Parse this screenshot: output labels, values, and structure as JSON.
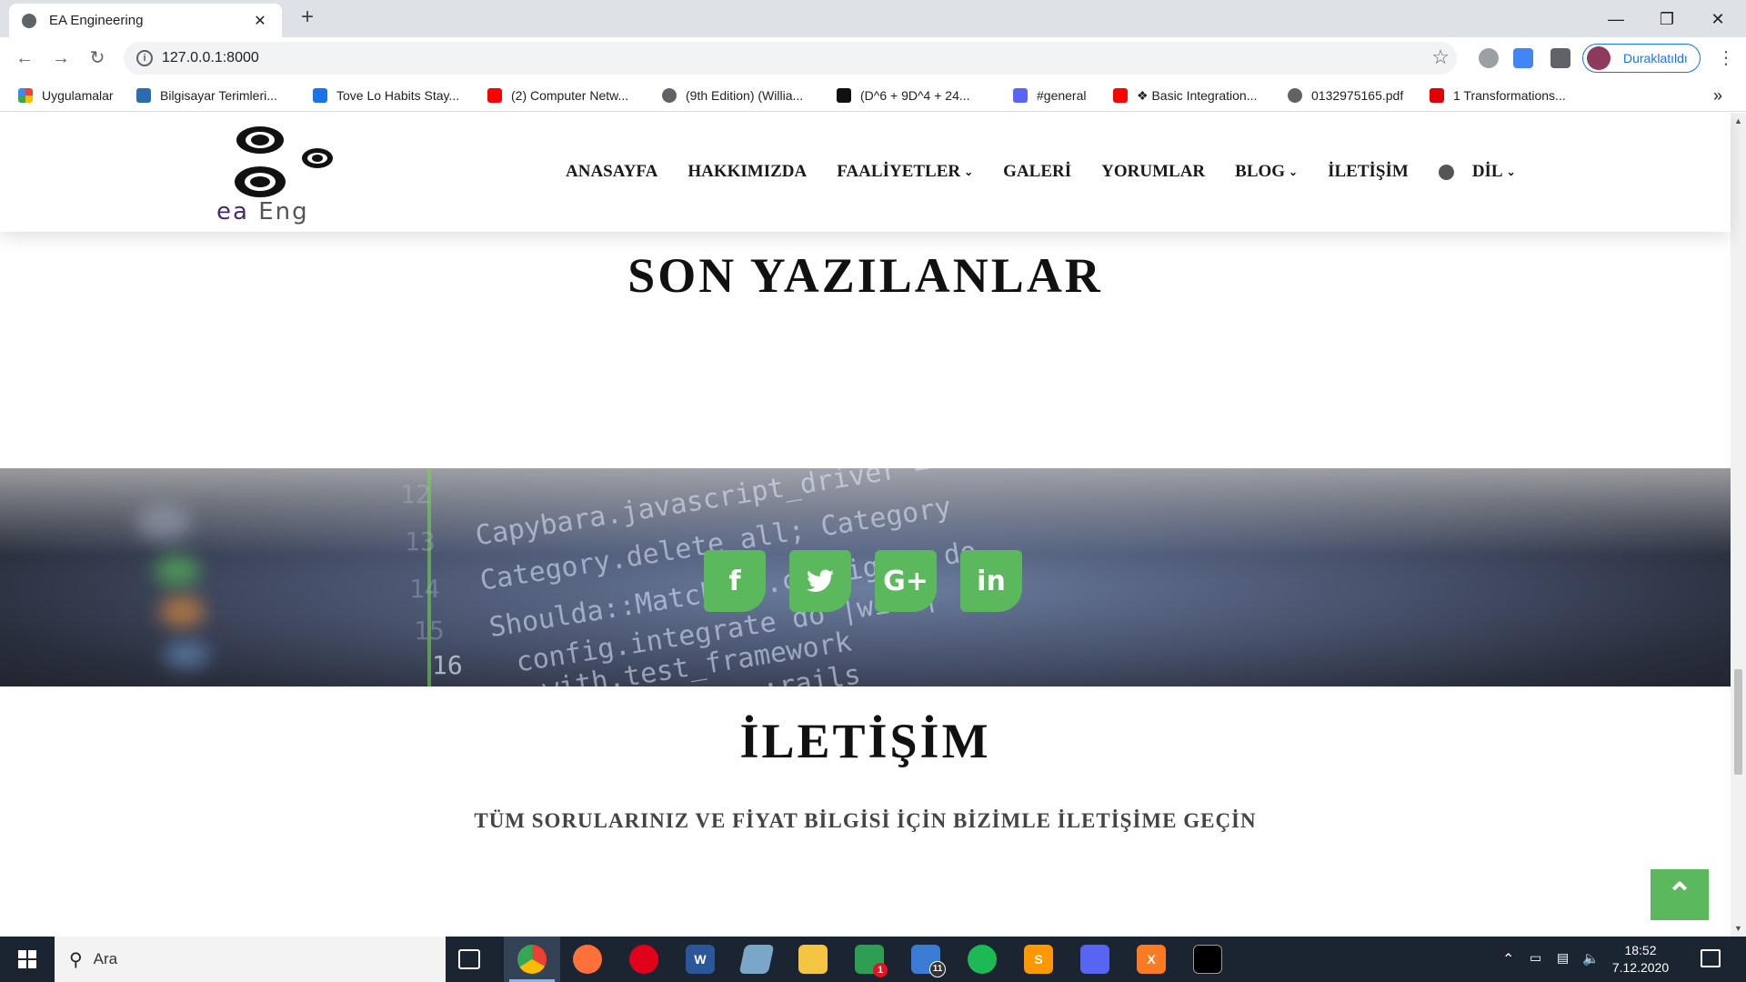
{
  "browser": {
    "tab_title": "EA Engineering",
    "tab_close": "✕",
    "new_tab": "+",
    "url": "127.0.0.1:8000",
    "profile_label": "Duraklatıldı",
    "bookmarks": [
      {
        "label": "Uygulamalar",
        "color": "#e8453c"
      },
      {
        "label": "Bilgisayar Terimleri...",
        "color": "#2b6cb0"
      },
      {
        "label": "Tove Lo Habits Stay...",
        "color": "#1a73e8"
      },
      {
        "label": "(2) Computer Netw...",
        "color": "#ff0000"
      },
      {
        "label": "(9th Edition) (Willia...",
        "color": "#5f6368"
      },
      {
        "label": "(D^6 + 9D^4 + 24...",
        "color": "#111111"
      },
      {
        "label": "#general",
        "color": "#5865f2"
      },
      {
        "label": "❖ Basic Integration...",
        "color": "#ff0000"
      },
      {
        "label": "0132975165.pdf",
        "color": "#5f6368"
      },
      {
        "label": "1 Transformations...",
        "color": "#e00000"
      }
    ],
    "bookmarks_overflow": "»"
  },
  "site": {
    "logo_text_ea": "ea",
    "logo_text_eng": "Eng",
    "nav": [
      {
        "label": "ANASAYFA",
        "dropdown": false
      },
      {
        "label": "HAKKIMIZDA",
        "dropdown": false
      },
      {
        "label": "FAALİYETLER",
        "dropdown": true
      },
      {
        "label": "GALERİ",
        "dropdown": false
      },
      {
        "label": "YORUMLAR",
        "dropdown": false
      },
      {
        "label": "BLOG",
        "dropdown": true
      },
      {
        "label": "İLETİŞİM",
        "dropdown": false
      }
    ],
    "language_label": "DİL",
    "latest_heading": "SON YAZILANLAR",
    "social": [
      {
        "name": "facebook",
        "glyph": "f"
      },
      {
        "name": "twitter",
        "glyph": "🐦"
      },
      {
        "name": "google-plus",
        "glyph": "G+"
      },
      {
        "name": "linkedin",
        "glyph": "in"
      }
    ],
    "code_lines": [
      {
        "no": "12",
        "text": "Capybara.javascript_driver = "
      },
      {
        "no": "13",
        "text": "Category.delete_all; Category"
      },
      {
        "no": "14",
        "text": "Shoulda::Matchers.configure do"
      },
      {
        "no": "15",
        "text": "config.integrate do |with|"
      },
      {
        "no": "16",
        "text": "with.test_framework"
      },
      {
        "no": "",
        "text": "with.library :rails"
      }
    ],
    "contact_heading": "İLETİŞİM",
    "contact_subtitle": "TÜM SORULARINIZ VE FİYAT BİLGİSİ İÇİN BİZİMLE İLETİŞİME GEÇİN",
    "accent_color": "#5cb85c"
  },
  "taskbar": {
    "search_placeholder": "Ara",
    "time": "18:52",
    "date": "7.12.2020",
    "mail_badge": "11",
    "whatsapp_badge": "1"
  }
}
